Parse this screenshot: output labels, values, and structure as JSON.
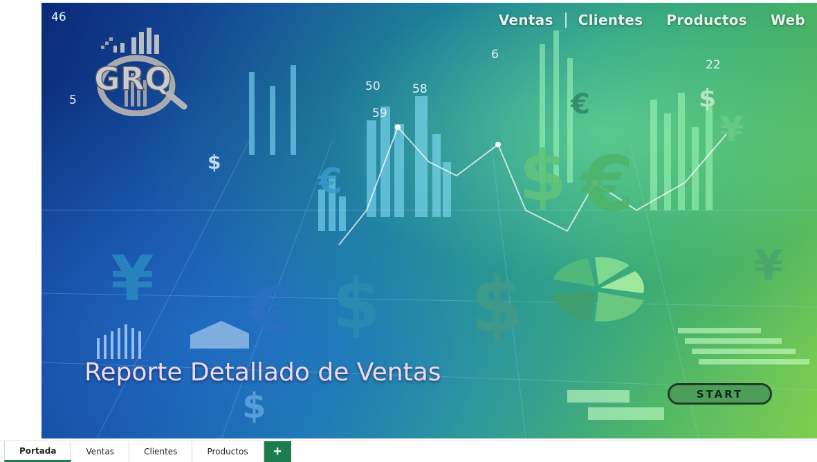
{
  "nav": {
    "items": [
      "Ventas",
      "Clientes",
      "Productos",
      "Web"
    ]
  },
  "logo": {
    "text": "GRQ"
  },
  "title": "Reporte Detallado de Ventas",
  "start_button": {
    "label": "START"
  },
  "sheet_tabs": {
    "tabs": [
      "Portada",
      "Ventas",
      "Clientes",
      "Productos"
    ],
    "active": "Portada",
    "add_icon": "plus-icon"
  },
  "colors": {
    "accent_green": "#1c7b4f",
    "start_fill": "#4e9e5a",
    "title_text": "#f0d9ef"
  }
}
